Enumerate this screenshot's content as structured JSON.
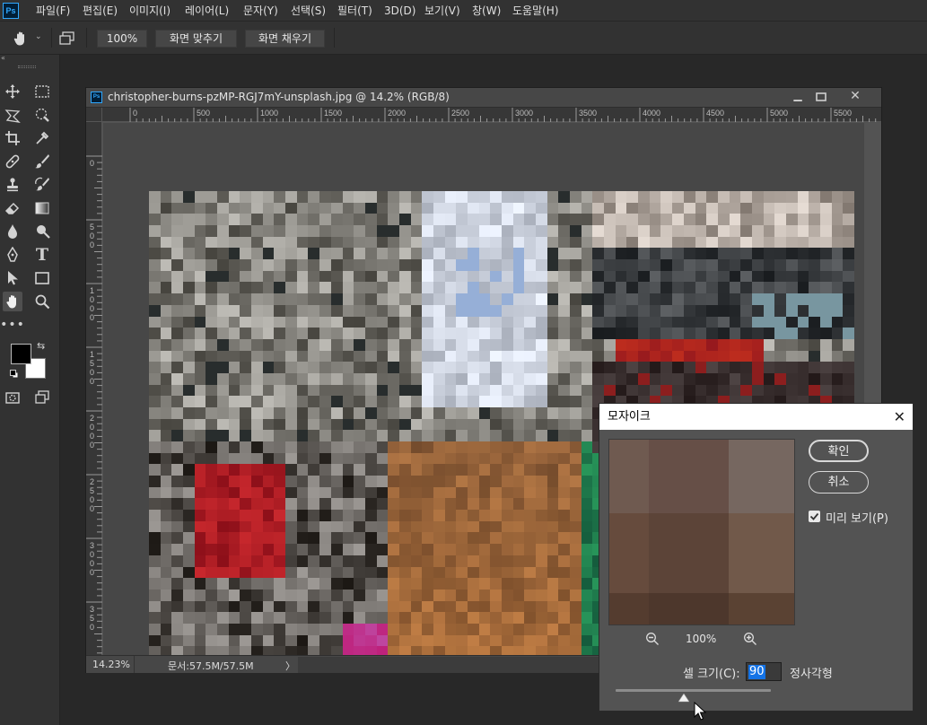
{
  "app": {
    "logo_text": "Ps"
  },
  "menu": [
    "파일(F)",
    "편집(E)",
    "이미지(I)",
    "레이어(L)",
    "문자(Y)",
    "선택(S)",
    "필터(T)",
    "3D(D)",
    "보기(V)",
    "창(W)",
    "도움말(H)"
  ],
  "options": {
    "zoom": "100%",
    "fit_screen": "화면 맞추기",
    "fill_screen": "화면 채우기"
  },
  "document": {
    "title": "christopher-burns-pzMP-RGJ7mY-unsplash.jpg @ 14.2% (RGB/8)",
    "ruler_h": [
      "0",
      "500",
      "1000",
      "1500",
      "2000",
      "2500",
      "3000",
      "3500",
      "4000",
      "4500",
      "5000",
      "5500"
    ],
    "ruler_v": [
      "0",
      "5\n0\n0",
      "1\n0\n0\n0",
      "1\n5\n0\n0",
      "2\n0\n0\n0",
      "2\n5\n0\n0",
      "3\n0\n0\n0",
      "3\n5\n0"
    ],
    "zoom": "14.23%",
    "doc_size": "문서:57.5M/57.5M",
    "status_arrow": "〉"
  },
  "dialog": {
    "title": "모자이크",
    "ok": "확인",
    "cancel": "취소",
    "preview_label": "미리 보기(P)",
    "preview_checked": true,
    "zoom": "100%",
    "cell_size_label": "셀 크기(C):",
    "cell_size_value": "90",
    "unit": "정사각형",
    "slider_fraction": 0.44
  },
  "colors": {
    "foreground": "#000000",
    "background": "#ffffff",
    "accent": "#1473e6"
  }
}
